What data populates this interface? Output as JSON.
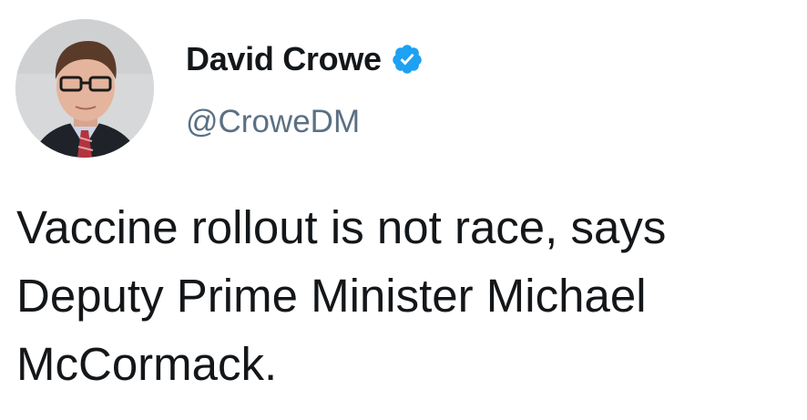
{
  "author": {
    "display_name": "David Crowe",
    "handle": "@CroweDM",
    "verified": true,
    "avatar_icon": "profile-photo",
    "verified_icon": "verified-badge-icon"
  },
  "tweet": {
    "line1": "Vaccine rollout is not race, says",
    "line2": "Deputy Prime Minister Michael",
    "line3": "McCormack."
  },
  "colors": {
    "text": "#14171a",
    "handle": "#5b7083",
    "verified": "#1da1f2"
  }
}
